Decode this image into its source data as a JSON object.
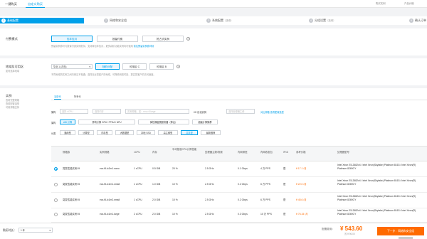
{
  "tabs": [
    {
      "label": "一键购买"
    },
    {
      "label": "自定义购买"
    }
  ],
  "topright": {
    "a": "购买实例",
    "b": "产品价格"
  },
  "steps": [
    {
      "num": "1",
      "label": "基础配置",
      "sub": ""
    },
    {
      "num": "2",
      "label": "网络和安全组",
      "sub": ""
    },
    {
      "num": "3",
      "label": "系统配置",
      "sub": "（选填）"
    },
    {
      "num": "4",
      "label": "分组设置",
      "sub": "（选填）"
    },
    {
      "num": "5",
      "label": "确认订单",
      "sub": ""
    }
  ],
  "billing": {
    "label": "付费模式",
    "options": [
      "包年包月",
      "按量付费",
      "抢占式实例"
    ],
    "note": "预留实例券可与按量付费实例抵扣，支持转包年包月，更多高阶功能实例均可使用",
    "link": "前往预留实例券详情"
  },
  "region": {
    "label": "地域及可用区",
    "sub": "如何选择地域",
    "region_value": "华北 1 (青岛)",
    "zones": [
      "随机分配",
      "可用区 C",
      "可用区 B"
    ],
    "note": "不同地域的实例之间内网互不相通；选择靠近您客户的地域，可降低网络时延、提高您客户的访问速度。"
  },
  "instance": {
    "label": "实例",
    "sub": [
      "查看完整规格",
      "查看配置选型",
      "可用规格支持"
    ],
    "subtabs": [
      "当前代",
      "所有代"
    ],
    "filters": {
      "arch_label": "架构",
      "vcpu_placeholder": "选择 vCPU",
      "mem_placeholder": "选择内存",
      "type_placeholder": "实例规格，如：ecs.c5.large",
      "io_label": "I/O 优化实例",
      "clock_placeholder": "选择处理器主频",
      "compare_link": "对比规格 查看配置选型"
    },
    "arch_options": [
      "x86 计算",
      "异构计算 GPU / FPGA / NPU",
      "弹性裸金属服务器（神龙）",
      "超级计算集群"
    ],
    "cat_label": "分类",
    "categories": [
      "通用型",
      "计算型",
      "内存型",
      "大数据型",
      "本地 SSD",
      "高主频型",
      "共享型",
      "最新推荐"
    ]
  },
  "table": {
    "headers": [
      "规格族",
      "实例规格",
      "vCPU",
      "内存",
      "平均基准CPU计算性能",
      "处理器主频/睿频",
      "内网带宽",
      "内网收发包",
      "IPv6",
      "参考价格",
      "处理器型号"
    ],
    "rows": [
      {
        "family": "突发性能实例 t5",
        "spec": "ecs.t5-lc2m1.nano",
        "vcpu": "1 vCPU",
        "mem": "0.5 GiB",
        "base": "20 %",
        "freq": "2.5 GHz",
        "bw": "0.1 Gbps",
        "pps": "4 万 PPS",
        "ipv6": "是",
        "price": "¥ 17.1 /月",
        "cpu": "Intel Xeon E5-2682v4 / Intel Xeon(Skylake) Platinum 8163 / Intel Xeon(R) Platinum 8269CY"
      },
      {
        "family": "突发性能实例 t5",
        "spec": "ecs.t5-lc1m1.small",
        "vcpu": "1 vCPU",
        "mem": "1.0 GiB",
        "base": "10 %",
        "freq": "2.5 GHz",
        "bw": "0.2 Gbps",
        "pps": "6 万 PPS",
        "ipv6": "是",
        "price": "¥ 22.0 /月",
        "cpu": "Intel Xeon E5-2682v4 / Intel Xeon(Skylake) Platinum 8163 / Intel Xeon(R) Platinum 8269CY"
      },
      {
        "family": "突发性能实例 t5",
        "spec": "ecs.t5-lc1m2.small",
        "vcpu": "1 vCPU",
        "mem": "2.0 GiB",
        "base": "10 %",
        "freq": "2.5 GHz",
        "bw": "0.2 Gbps",
        "pps": "6 万 PPS",
        "ipv6": "是",
        "price": "¥ 45.6 /月",
        "cpu": "Intel Xeon E5-2682v4 / Intel Xeon(Skylake) Platinum 8163 / Intel Xeon(R) Platinum 8269CY"
      },
      {
        "family": "突发性能实例 t5",
        "spec": "ecs.t5-lc1m1.large",
        "vcpu": "2 vCPU",
        "mem": "2.0 GiB",
        "base": "10 %",
        "freq": "2.5 GHz",
        "bw": "0.3 Gbps",
        "pps": "10 万 PPS",
        "ipv6": "是",
        "price": "¥ 76.15 /月",
        "cpu": "Intel Xeon E5-2682v4 / Intel Xeon(Skylake) Platinum 8163 / Intel Xeon(R) Platinum 8269CY"
      }
    ]
  },
  "footer": {
    "duration_label": "购买时长：",
    "duration_value": "1 年",
    "fee_label": "配置费用：",
    "fee_value": "¥ 543.60",
    "discount_label": "省 ¥ 96.00",
    "next_button": "下一步：网络和安全组"
  }
}
